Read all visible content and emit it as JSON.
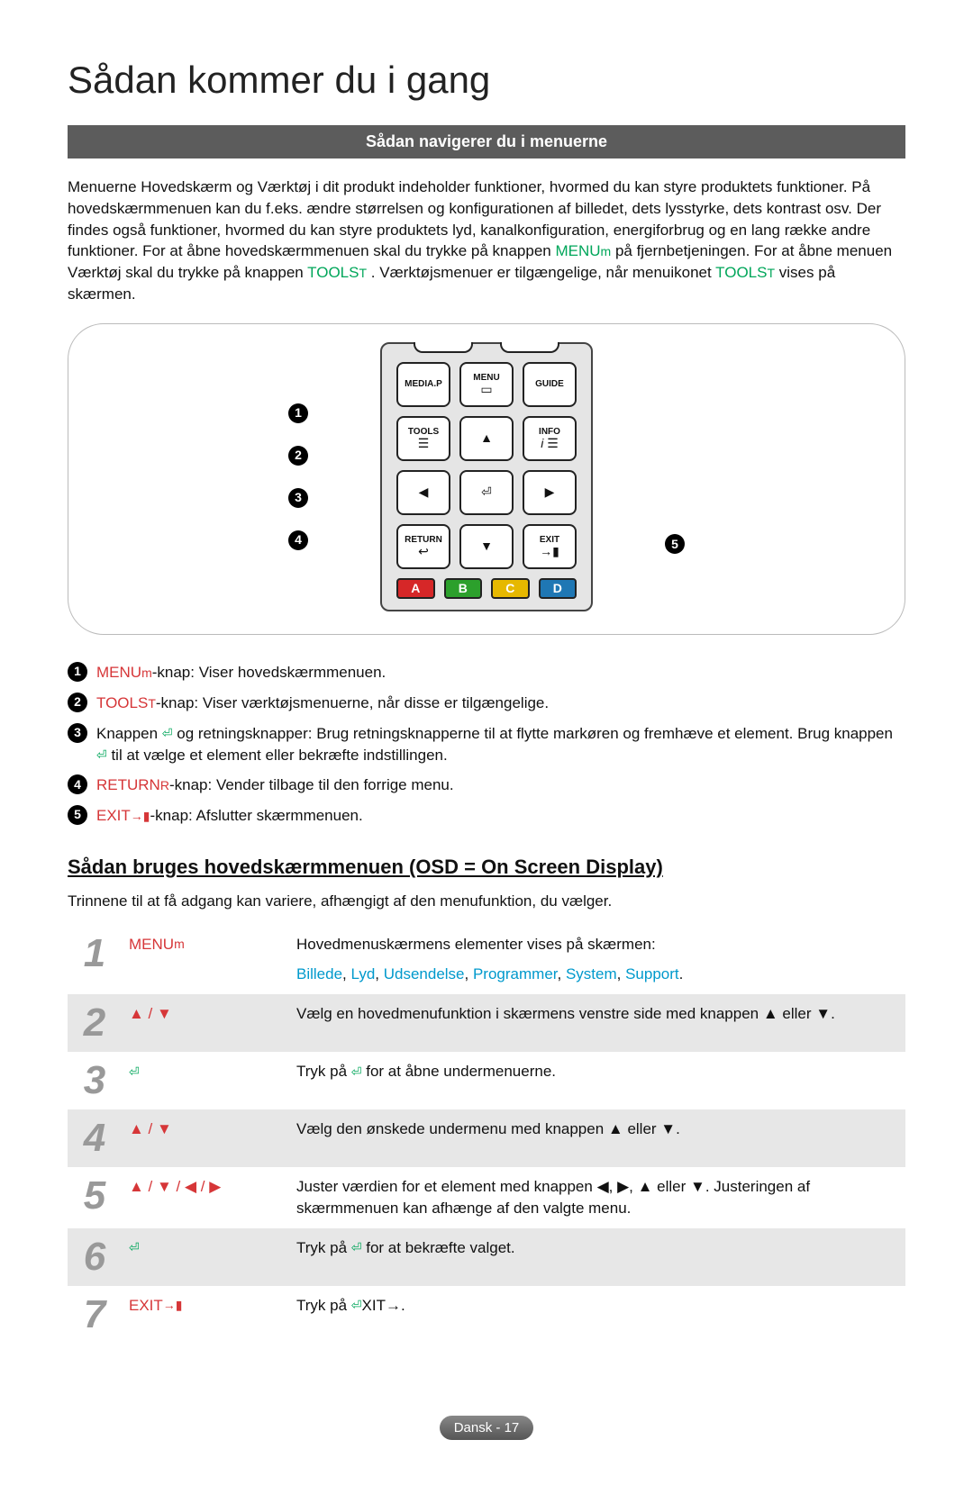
{
  "title": "Sådan kommer du i gang",
  "section_bar": "Sådan navigerer du i menuerne",
  "intro": {
    "p1a": "Menuerne Hovedskærm og Værktøj i dit produkt indeholder funktioner, hvormed du kan styre produktets funktioner. På hovedskærmmenuen kan du f.eks. ændre størrelsen og konfigurationen af billedet, dets lysstyrke, dets kontrast osv. Der findes også funktioner, hvormed du kan styre produktets lyd, kanalkonfiguration, energiforbrug og en lang række andre funktioner. For at åbne hovedskærmmenuen skal du trykke på knappen ",
    "menu_label": "MENU",
    "p1b": " på fjernbetjeningen. For at åbne menuen Værktøj skal du trykke på knappen ",
    "tools_label": "TOOLS",
    "p1c": ". Værktøjsmenuer er tilgængelige, når menuikonet ",
    "p1d": " vises på skærmen."
  },
  "remote": {
    "mediap": "MEDIA.P",
    "menu": "MENU",
    "guide": "GUIDE",
    "tools": "TOOLS",
    "info": "INFO",
    "return": "RETURN",
    "exit": "EXIT"
  },
  "legend": [
    {
      "num": "1",
      "kw": "MENU",
      "rest": "-knap: Viser hovedskærmmenuen.",
      "kw_class": "kw-red"
    },
    {
      "num": "2",
      "kw": "TOOLS",
      "rest": "-knap: Viser værktøjsmenuerne, når disse er tilgængelige.",
      "kw_class": "kw-red"
    },
    {
      "num": "3",
      "kw": "",
      "rest": "Knappen E og retningsknapper: Brug retningsknapperne til at flytte markøren og fremhæve et element. Brug knappen E til at vælge et element eller bekræfte indstillingen.",
      "kw_class": ""
    },
    {
      "num": "4",
      "kw": "RETURN",
      "rest": "-knap: Vender tilbage til den forrige menu.",
      "kw_class": "kw-red"
    },
    {
      "num": "5",
      "kw": "EXIT",
      "rest": "-knap: Afslutter skærmmenuen.",
      "kw_class": "kw-red"
    }
  ],
  "subhead": "Sådan bruges hovedskærmmenuen (OSD = On Screen Display)",
  "subtext": "Trinnene til at få adgang kan variere, afhængigt af den menufunktion, du vælger.",
  "steps": [
    {
      "n": "1",
      "key": "MENUm",
      "descA": "Hovedmenuskærmens elementer vises på skærmen:",
      "descMenuLine": "Billede, Lyd, Udsendelse, Programmer, System, Support."
    },
    {
      "n": "2",
      "key": "▲ / ▼",
      "descA": "Vælg en hovedmenufunktion i skærmens venstre side med knappen ▲ eller ▼."
    },
    {
      "n": "3",
      "key": "E",
      "descA": "Tryk på E for at åbne undermenuerne."
    },
    {
      "n": "4",
      "key": "▲ / ▼",
      "descA": "Vælg den ønskede undermenu med knappen ▲ eller ▼."
    },
    {
      "n": "5",
      "key": "▲ / ▼ / ◀ / ▶",
      "descA": "Juster værdien for et element med knappen ◀, ▶, ▲ eller ▼. Justeringen af skærmmenuen kan afhænge af den valgte menu."
    },
    {
      "n": "6",
      "key": "E",
      "descA": "Tryk på E for at bekræfte valget."
    },
    {
      "n": "7",
      "key": "EXIT→",
      "descA": "Tryk på EXIT→."
    }
  ],
  "step7_key_red": "EXIT",
  "step7_desc_prefix": "Tryk på ",
  "step7_desc_red": "EXIT",
  "footer": "Dansk - 17"
}
